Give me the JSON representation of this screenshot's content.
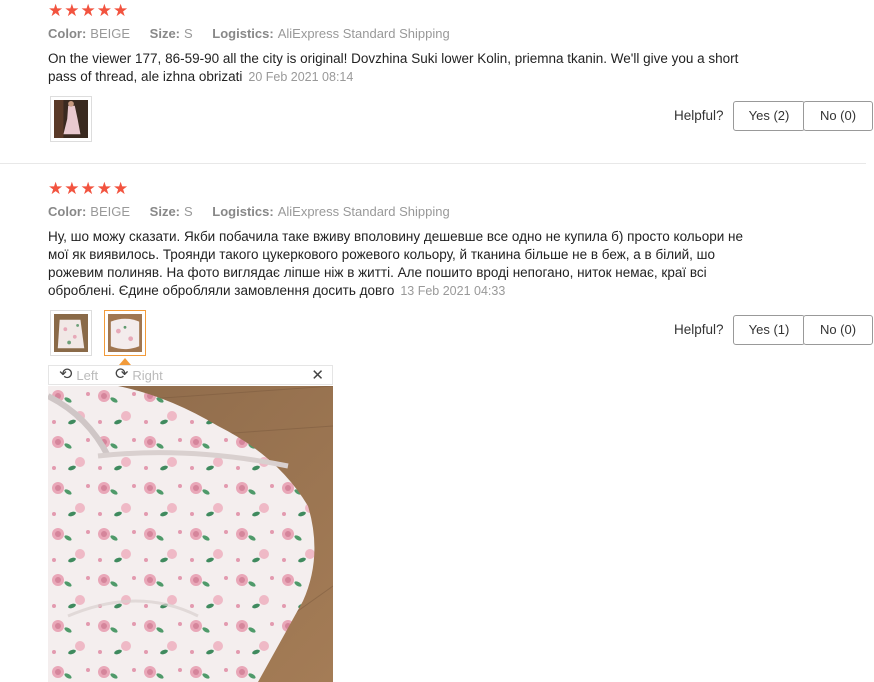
{
  "reviews": [
    {
      "rating": 5,
      "color_label": "Color:",
      "color_value": "BEIGE",
      "size_label": "Size:",
      "size_value": "S",
      "logistics_label": "Logistics:",
      "logistics_value": "AliExpress Standard Shipping",
      "text_line1": "On the viewer 177, 86-59-90 all the city is original! Dovzhina Suki lower Kolin, priemna tkanin. We'll give you a short",
      "text_line2": "pass of thread, ale izhna obrizati",
      "date": "20 Feb 2021 08:14",
      "helpful_label": "Helpful?",
      "yes_label": "Yes (2)",
      "no_label": "No (0)"
    },
    {
      "rating": 5,
      "color_label": "Color:",
      "color_value": "BEIGE",
      "size_label": "Size:",
      "size_value": "S",
      "logistics_label": "Logistics:",
      "logistics_value": "AliExpress Standard Shipping",
      "text_line1": "Ну, шо можу сказати. Якби побачила таке вживу вполовину дешевше все одно не купила б) просто кольори не",
      "text_line2": "мої як виявилось. Троянди такого цукеркового рожевого кольору, й тканина більше не в беж, а в білий, шо",
      "text_line3": "рожевим полиняв. На фото виглядає ліпше ніж в житті. Але пошито вроді непогано, ниток немає, краї всі",
      "text_line4": "оброблені. Єдине обробляли замовлення досить довго",
      "date": "13 Feb 2021 04:33",
      "helpful_label": "Helpful?",
      "yes_label": "Yes (1)",
      "no_label": "No (0)"
    }
  ],
  "viewer": {
    "rotate_left_label": "Left",
    "rotate_right_label": "Right",
    "rotate_left_icon": "rotate-left-icon",
    "rotate_right_icon": "rotate-right-icon",
    "close_icon": "close-icon"
  },
  "colors": {
    "star": "#f2533f",
    "active_thumb_border": "#f29b3a"
  }
}
